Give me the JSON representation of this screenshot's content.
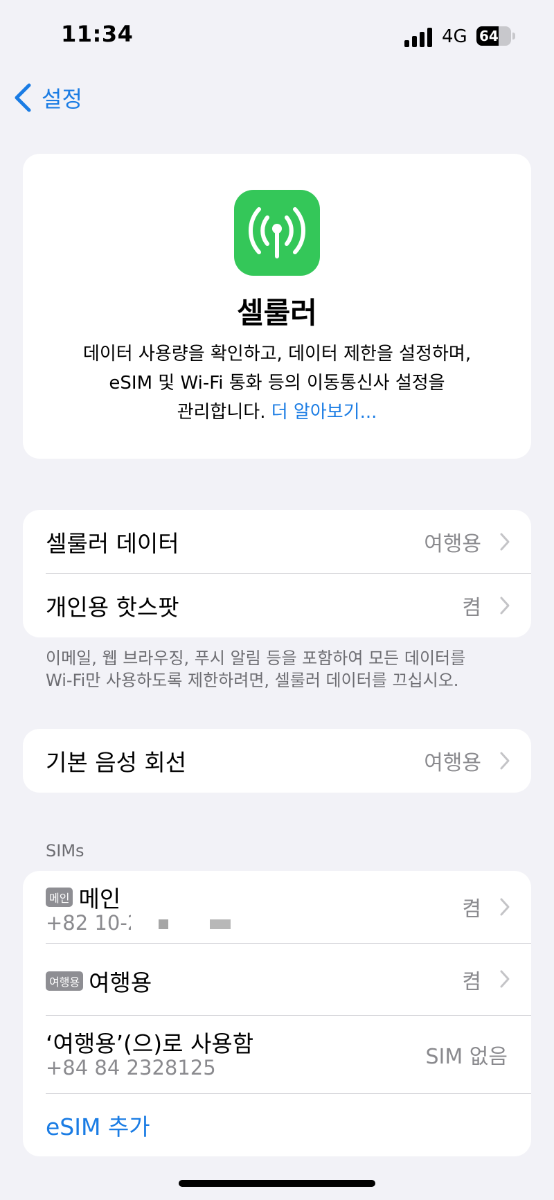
{
  "status_bar": {
    "time": "11:34",
    "network": "4G",
    "battery_percent": "64"
  },
  "nav": {
    "back_label": "설정"
  },
  "hero": {
    "title": "셀룰러",
    "description_lines": [
      "데이터 사용량을 확인하고, 데이터 제한을 설정하며,",
      "eSIM 및 Wi-Fi 통화 등의 이동통신사 설정을"
    ],
    "description_tail": "관리합니다.",
    "learn_more": "더 알아보기..."
  },
  "group1": {
    "rows": [
      {
        "label": "셀룰러 데이터",
        "value": "여행용"
      },
      {
        "label": "개인용 핫스팟",
        "value": "켬"
      }
    ],
    "footnote_lines": [
      "이메일, 웹 브라우징, 푸시 알림 등을 포함하여 모든 데이터를",
      "Wi-Fi만 사용하도록 제한하려면, 셀룰러 데이터를 끄십시오."
    ]
  },
  "group2": {
    "rows": [
      {
        "label": "기본 음성 회선",
        "value": "여행용"
      }
    ]
  },
  "sims": {
    "header": "SIMs",
    "main": {
      "badge": "메인",
      "label": "메인",
      "number": "+82 10-2",
      "value": "켬"
    },
    "travel": {
      "badge": "여행용",
      "label": "여행용",
      "value": "켬"
    },
    "use_as": {
      "label": "‘여행용’(으)로 사용함",
      "number": "+84 84 2328125",
      "value": "SIM 없음"
    },
    "add_esim": "eSIM 추가"
  },
  "colors": {
    "accent": "#1a7ce4",
    "icon_green": "#34c759",
    "background": "#f2f2f7"
  }
}
